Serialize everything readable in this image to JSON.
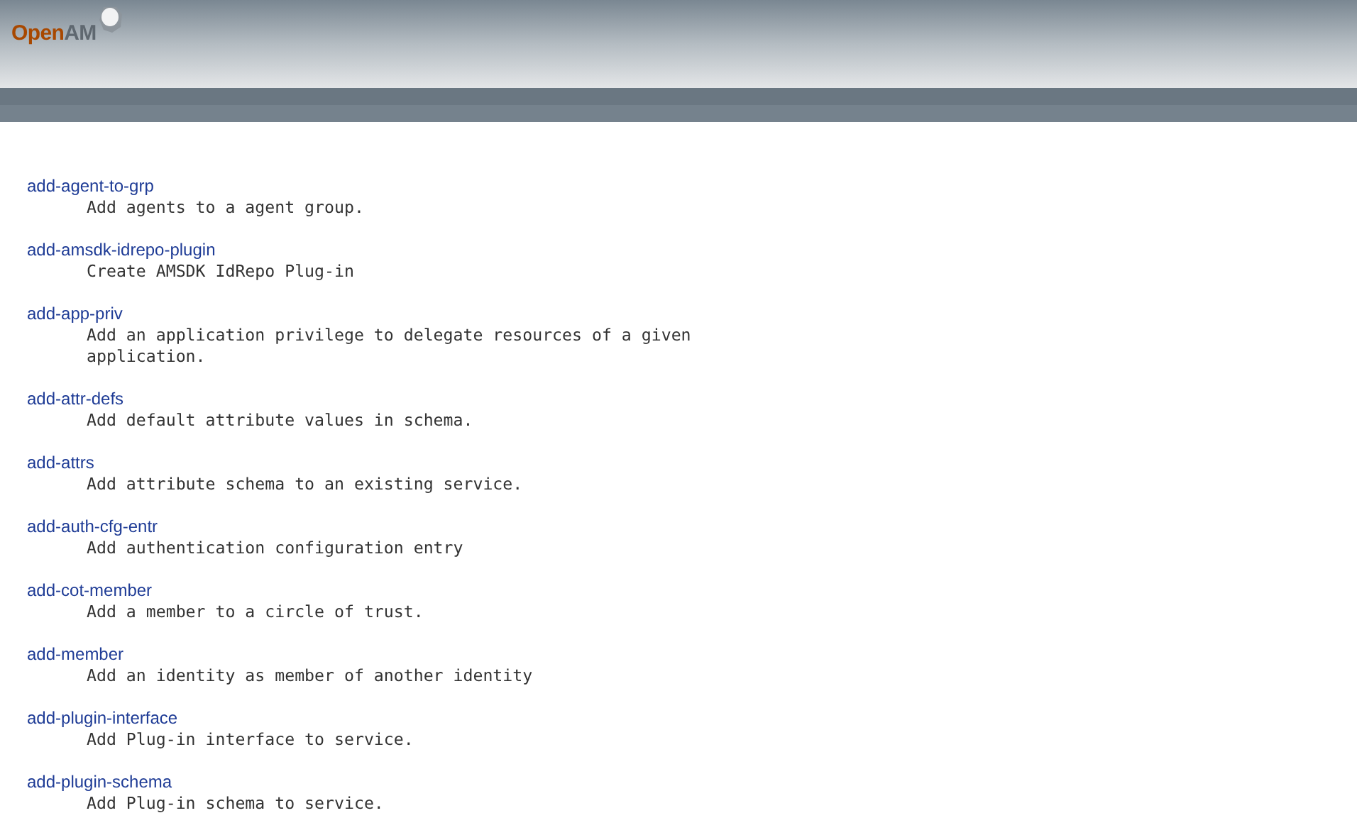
{
  "header": {
    "logo": {
      "first": "Open",
      "second": "AM"
    }
  },
  "commands": [
    {
      "name": "add-agent-to-grp",
      "description": "Add agents to a agent group."
    },
    {
      "name": "add-amsdk-idrepo-plugin",
      "description": "Create AMSDK IdRepo Plug-in"
    },
    {
      "name": "add-app-priv",
      "description": "Add an application privilege to delegate resources of a given application."
    },
    {
      "name": "add-attr-defs",
      "description": "Add default attribute values in schema."
    },
    {
      "name": "add-attrs",
      "description": "Add attribute schema to an existing service."
    },
    {
      "name": "add-auth-cfg-entr",
      "description": "Add authentication configuration entry"
    },
    {
      "name": "add-cot-member",
      "description": "Add a member to a circle of trust."
    },
    {
      "name": "add-member",
      "description": "Add an identity as member of another identity"
    },
    {
      "name": "add-plugin-interface",
      "description": "Add Plug-in interface to service."
    },
    {
      "name": "add-plugin-schema",
      "description": "Add Plug-in schema to service."
    }
  ]
}
